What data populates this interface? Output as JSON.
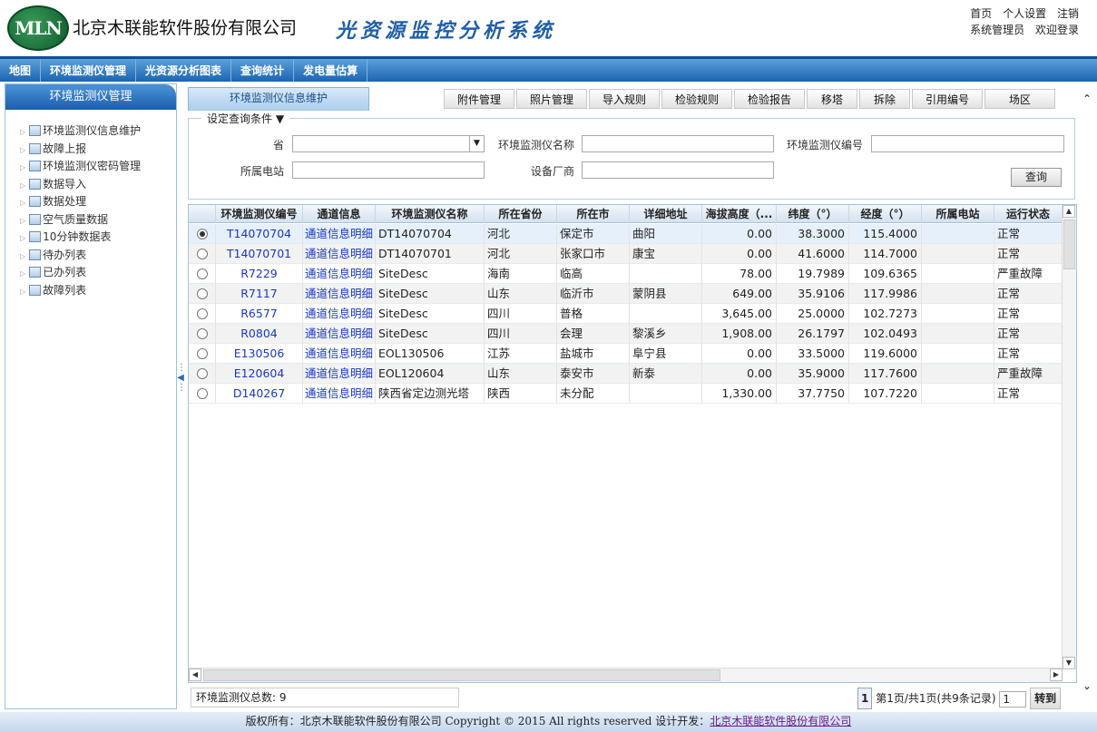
{
  "header": {
    "logo_text": "MLN",
    "company": "北京木联能软件股份有限公司",
    "system_name": "光资源监控分析系统",
    "links": [
      "首页",
      "个人设置",
      "注销"
    ],
    "user": "系统管理员",
    "welcome": "欢迎登录"
  },
  "nav": [
    "地图",
    "环境监测仪管理",
    "光资源分析图表",
    "查询统计",
    "发电量估算"
  ],
  "sidebar": {
    "title": "环境监测仪管理",
    "items": [
      "环境监测仪信息维护",
      "故障上报",
      "环境监测仪密码管理",
      "数据导入",
      "数据处理",
      "空气质量数据",
      "10分钟数据表",
      "待办列表",
      "已办列表",
      "故障列表"
    ]
  },
  "tabs": {
    "active": "环境监测仪信息维护",
    "buttons": [
      "附件管理",
      "照片管理",
      "导入规则",
      "检验规则",
      "检验报告",
      "移塔",
      "拆除",
      "引用编号",
      "场区"
    ]
  },
  "query": {
    "legend": "设定查询条件 ▼",
    "province_label": "省",
    "name_label": "环境监测仪名称",
    "code_label": "环境监测仪编号",
    "station_label": "所属电站",
    "vendor_label": "设备厂商",
    "search_button": "查询"
  },
  "table": {
    "columns": [
      "环境监测仪编号",
      "通道信息",
      "环境监测仪名称",
      "所在省份",
      "所在市",
      "详细地址",
      "海拔高度（...",
      "纬度（°）",
      "经度（°）",
      "所属电站",
      "运行状态"
    ],
    "rows": [
      {
        "code": "T14070704",
        "chan": "通道信息明细",
        "name": "DT14070704",
        "prov": "河北",
        "city": "保定市",
        "addr": "曲阳",
        "alt": "0.00",
        "lat": "38.3000",
        "lon": "115.4000",
        "station": "",
        "status": "正常"
      },
      {
        "code": "T14070701",
        "chan": "通道信息明细",
        "name": "DT14070701",
        "prov": "河北",
        "city": "张家口市",
        "addr": "康宝",
        "alt": "0.00",
        "lat": "41.6000",
        "lon": "114.7000",
        "station": "",
        "status": "正常"
      },
      {
        "code": "R7229",
        "chan": "通道信息明细",
        "name": "SiteDesc",
        "prov": "海南",
        "city": "临高",
        "addr": "",
        "alt": "78.00",
        "lat": "19.7989",
        "lon": "109.6365",
        "station": "",
        "status": "严重故障"
      },
      {
        "code": "R7117",
        "chan": "通道信息明细",
        "name": "SiteDesc",
        "prov": "山东",
        "city": "临沂市",
        "addr": "蒙阴县",
        "alt": "649.00",
        "lat": "35.9106",
        "lon": "117.9986",
        "station": "",
        "status": "正常"
      },
      {
        "code": "R6577",
        "chan": "通道信息明细",
        "name": "SiteDesc",
        "prov": "四川",
        "city": "普格",
        "addr": "",
        "alt": "3,645.00",
        "lat": "25.0000",
        "lon": "102.7273",
        "station": "",
        "status": "正常"
      },
      {
        "code": "R0804",
        "chan": "通道信息明细",
        "name": "SiteDesc",
        "prov": "四川",
        "city": "会理",
        "addr": "黎溪乡",
        "alt": "1,908.00",
        "lat": "26.1797",
        "lon": "102.0493",
        "station": "",
        "status": "正常"
      },
      {
        "code": "E130506",
        "chan": "通道信息明细",
        "name": "EOL130506",
        "prov": "江苏",
        "city": "盐城市",
        "addr": "阜宁县",
        "alt": "0.00",
        "lat": "33.5000",
        "lon": "119.6000",
        "station": "",
        "status": "正常"
      },
      {
        "code": "E120604",
        "chan": "通道信息明细",
        "name": "EOL120604",
        "prov": "山东",
        "city": "泰安市",
        "addr": "新泰",
        "alt": "0.00",
        "lat": "35.9000",
        "lon": "117.7600",
        "station": "",
        "status": "严重故障"
      },
      {
        "code": "D140267",
        "chan": "通道信息明细",
        "name": "陕西省定边测光塔",
        "prov": "陕西",
        "city": "未分配",
        "addr": "",
        "alt": "1,330.00",
        "lat": "37.7750",
        "lon": "107.7220",
        "station": "",
        "status": "正常"
      }
    ]
  },
  "footer": {
    "total_label": "环境监测仪总数:",
    "total": "9",
    "page_current": "1",
    "page_info": "第1页/共1页(共9条记录)",
    "page_input": "1",
    "go_button": "转到"
  },
  "copyright": {
    "text": "版权所有：北京木联能软件股份有限公司  Copyright © 2015 All rights reserved 设计开发：",
    "link": "北京木联能软件股份有限公司"
  }
}
